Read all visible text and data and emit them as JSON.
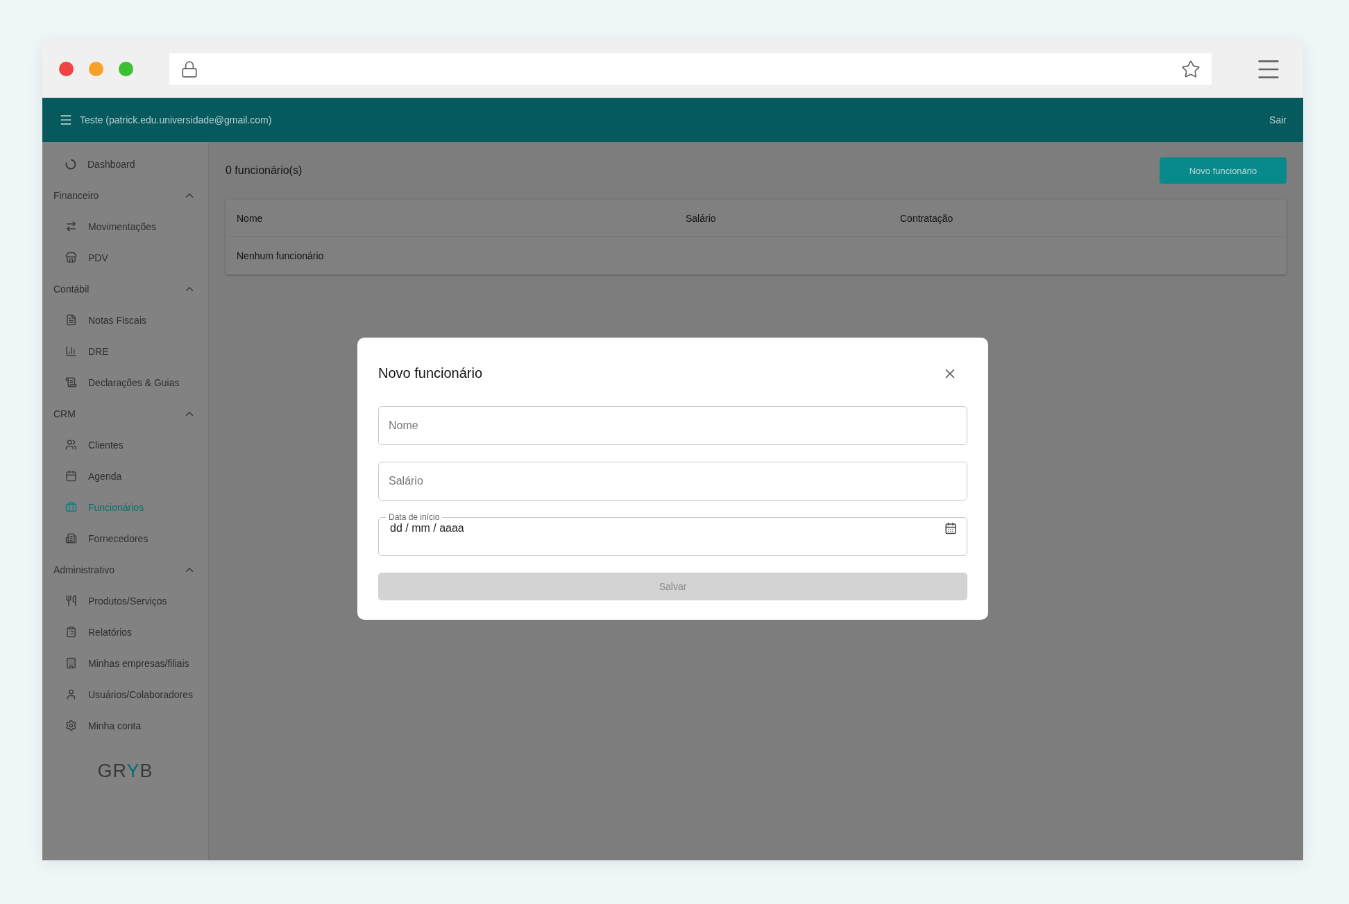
{
  "app_bar": {
    "user": "Teste (patrick.edu.universidade@gmail.com)",
    "logout": "Sair"
  },
  "sidebar": {
    "items": [
      {
        "kind": "link",
        "label": "Dashboard",
        "selected": false
      },
      {
        "kind": "section",
        "label": "Financeiro",
        "expanded": true,
        "children": [
          {
            "label": "Movimentações",
            "selected": false
          },
          {
            "label": "PDV",
            "selected": false
          }
        ]
      },
      {
        "kind": "section",
        "label": "Contábil",
        "expanded": true,
        "children": [
          {
            "label": "Notas Fiscais",
            "selected": false
          },
          {
            "label": "DRE",
            "selected": false
          },
          {
            "label": "Declarações & Guias",
            "selected": false
          }
        ]
      },
      {
        "kind": "section",
        "label": "CRM",
        "expanded": true,
        "children": [
          {
            "label": "Clientes",
            "selected": false
          },
          {
            "label": "Agenda",
            "selected": false
          },
          {
            "label": "Funcionários",
            "selected": true
          },
          {
            "label": "Fornecedores",
            "selected": false
          }
        ]
      },
      {
        "kind": "section",
        "label": "Administrativo",
        "expanded": true,
        "children": [
          {
            "label": "Produtos/Serviços",
            "selected": false
          },
          {
            "label": "Relatórios",
            "selected": false
          },
          {
            "label": "Minhas empresas/filiais",
            "selected": false
          },
          {
            "label": "Usuários/Colaboradores",
            "selected": false
          },
          {
            "label": "Minha conta",
            "selected": false
          }
        ]
      }
    ],
    "logo": [
      {
        "text": "GR",
        "accent": false
      },
      {
        "text": "Y",
        "accent": true
      },
      {
        "text": "B",
        "accent": false
      }
    ]
  },
  "page": {
    "count": "0 funcionário(s)",
    "new_button": "Novo funcionário"
  },
  "table": {
    "columns": [
      "Nome",
      "Salário",
      "Contratação"
    ],
    "empty": "Nenhum funcionário"
  },
  "dialog": {
    "title": "Novo funcionário",
    "fields": [
      {
        "kind": "text",
        "placeholder": "Nome"
      },
      {
        "kind": "text",
        "placeholder": "Salário"
      },
      {
        "kind": "date",
        "label": "Data de início",
        "value": "dd / mm / aaaa"
      }
    ],
    "submit": {
      "label": "Salvar",
      "disabled": true
    }
  }
}
